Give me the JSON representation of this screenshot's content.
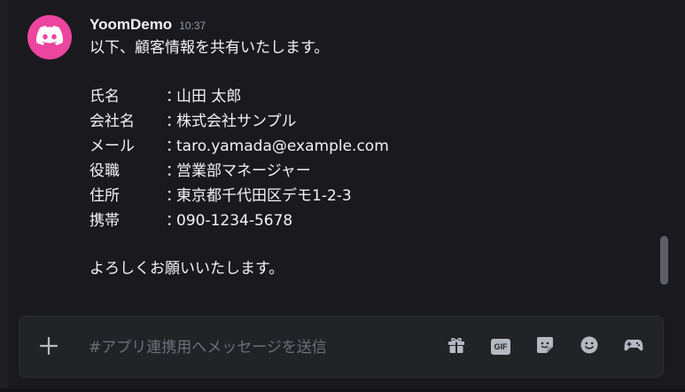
{
  "message": {
    "username": "YoomDemo",
    "timestamp": "10:37",
    "intro": "以下、顧客情報を共有いたします。",
    "fields": [
      {
        "label": "氏名",
        "sep": "：",
        "value": "山田 太郎"
      },
      {
        "label": "会社名",
        "sep": "：",
        "value": "株式会社サンプル"
      },
      {
        "label": "メール",
        "sep": "：",
        "value": "taro.yamada@example.com"
      },
      {
        "label": "役職",
        "sep": "：",
        "value": "営業部マネージャー"
      },
      {
        "label": "住所",
        "sep": "：",
        "value": "東京都千代田区デモ1-2-3"
      },
      {
        "label": "携帯",
        "sep": "：",
        "value": "090-1234-5678"
      }
    ],
    "closing": "よろしくお願いいたします。"
  },
  "composer": {
    "placeholder": "#アプリ連携用へメッセージを送信",
    "value": "",
    "icons": [
      "gift-icon",
      "gif-icon",
      "sticker-icon",
      "emoji-icon",
      "activities-icon"
    ],
    "gif_label": "GIF"
  },
  "colors": {
    "background": "#1a1a1e",
    "avatar": "#eb459f",
    "text": "#f2f3f5",
    "muted": "#949ba4",
    "placeholder": "#6d6f78",
    "composer_bg": "#222327",
    "icon": "#b5bac1"
  }
}
